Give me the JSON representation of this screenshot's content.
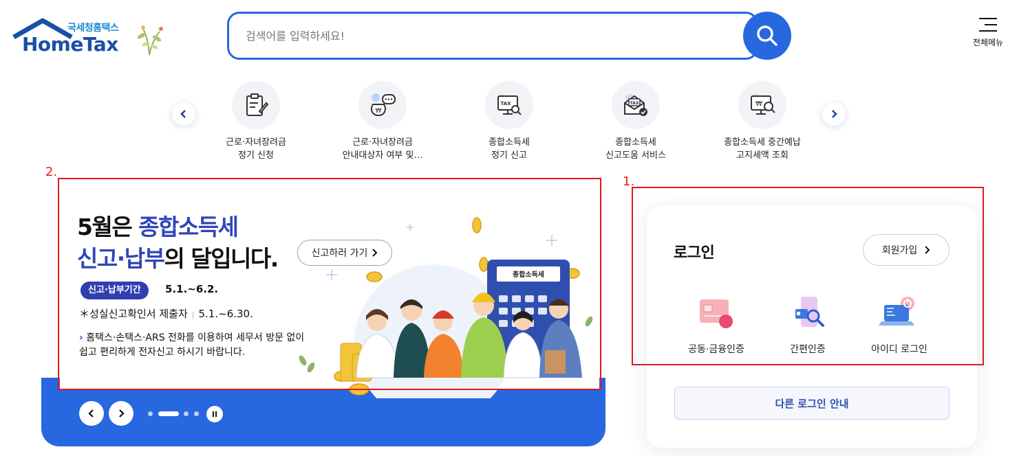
{
  "header": {
    "logo_sub": "국세청홈택스",
    "logo_main": "HomeTax",
    "search_placeholder": "검색어를 입력하세요!",
    "menu_label": "전체메뉴"
  },
  "quick_services": [
    {
      "line1": "근로·자녀장려금",
      "line2": "정기 신청",
      "icon": "clipboard-pen-icon"
    },
    {
      "line1": "근로·자녀장려금",
      "line2": "안내대상자 여부 및…",
      "icon": "money-bag-chat-icon"
    },
    {
      "line1": "종합소득세",
      "line2": "정기 신고",
      "icon": "tax-monitor-search-icon"
    },
    {
      "line1": "종합소득세",
      "line2": "신고도움 서비스",
      "icon": "tax-envelope-check-icon"
    },
    {
      "line1": "종합소득세 중간예납",
      "line2": "고지세액 조회",
      "icon": "won-monitor-search-icon"
    }
  ],
  "annotations": {
    "box1": "1.",
    "box2": "2."
  },
  "banner": {
    "title_line1_prefix": "5월은 ",
    "title_line1_highlight": "종합소득세",
    "title_line2_highlight": "신고·납부",
    "title_line2_suffix": "의 달입니다.",
    "cta_label": "신고하러 가기",
    "badge": "신고·납부기간",
    "period": "5.1.~6.2.",
    "line2_label": "＊성실신고확인서 제출자",
    "line2_period": "5.1.~6.30.",
    "note_line1": "홈택스·손택스·ARS 전화를 이용하여 세무서 방문 없이",
    "note_line2": "쉽고 편리하게 전자신고 하시기 바랍니다.",
    "calculator_label": "종합소득세"
  },
  "login": {
    "title": "로그인",
    "join_label": "회원가입",
    "options": [
      {
        "label": "공동·금융인증",
        "icon": "certificate-card-icon"
      },
      {
        "label": "간편인증",
        "icon": "phone-search-icon"
      },
      {
        "label": "아이디 로그인",
        "icon": "laptop-power-icon"
      }
    ],
    "other_login_label": "다른 로그인 안내"
  },
  "colors": {
    "brand_blue": "#2767e0",
    "highlight_navy": "#2f45b8",
    "annotation_red": "#e3181b"
  }
}
